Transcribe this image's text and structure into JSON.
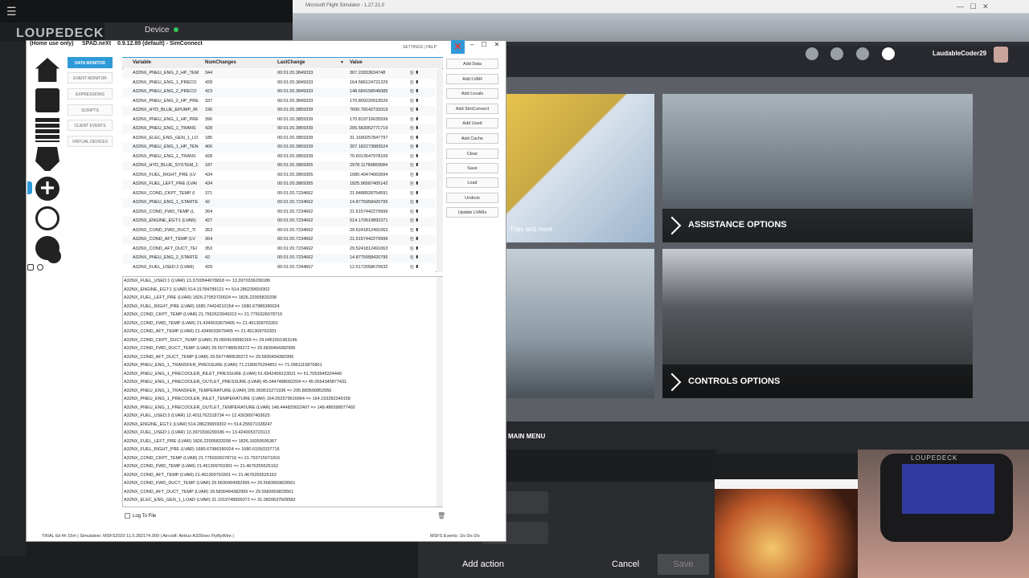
{
  "loupedeck": {
    "logo": "LOUPEDECK",
    "device_label": "Device",
    "buttons": {
      "add_action": "Add action",
      "cancel": "Cancel",
      "save": "Save"
    }
  },
  "msfs": {
    "window_title": "Microsoft Flight Simulator - 1.27.21.0",
    "username": "LaudableCoder29",
    "trips": "Trips and more",
    "assistance": "ASSISTANCE OPTIONS",
    "controls": "CONTROLS OPTIONS",
    "main_menu": "MAIN MENU"
  },
  "spad": {
    "home_use": "(Home use only)",
    "app_name": "SPAD.neXt",
    "version": "0.9.12.89 (default) - SimConnect",
    "settings_help": "SETTINGS | HELP",
    "nav": [
      "DATA MONITOR",
      "EVENT MONITOR",
      "EXPRESSIONS",
      "SCRIPTS",
      "CLIENT EVENTS",
      "VIRTUAL DEVICES"
    ],
    "grid": {
      "headers": [
        "Variable",
        "NumChanges",
        "LastChange",
        "Value"
      ],
      "rows": [
        [
          "A32NX_PNEU_ENG_2_HP_TEM",
          "344",
          "00:01:20.3849333",
          "307.22833634748"
        ],
        [
          "A32NX_PNEU_ENG_1_PRECO",
          "428",
          "00:01:20.3849333",
          "164.586124721229"
        ],
        [
          "A32NX_PNEU_ENG_2_PRECO",
          "423",
          "00:01:20.3849333",
          "148.684158046085"
        ],
        [
          "A32NX_PNEU_ENG_2_HP_PRE",
          "337",
          "00:01:20.3849333",
          "170.809220919526"
        ],
        [
          "A32NX_HYD_BLUE_EPUMP_RI",
          "196",
          "00:01:20.3859339",
          "7600.78142732019"
        ],
        [
          "A32NX_PNEU_ENG_1_HP_PRE",
          "396",
          "00:01:20.3859339",
          "170.819716635599"
        ],
        [
          "A32NX_PNEU_ENG_1_TRANS",
          "428",
          "00:01:20.3859339",
          "205.583052771719"
        ],
        [
          "A32NX_ELEC_ENG_GEN_1_LO",
          "185",
          "00:01:20.3859339",
          "31.1690257847797"
        ],
        [
          "A32NX_PNEU_ENG_1_HP_TEN",
          "406",
          "00:01:20.3859339",
          "307.182273883524"
        ],
        [
          "A32NX_PNEU_ENG_1_TRANS",
          "428",
          "00:01:20.3859339",
          "70.6013547978106"
        ],
        [
          "A32NX_HYD_BLUE_SYSTEM_1",
          "187",
          "00:01:20.3869355",
          "2978.11789869584"
        ],
        [
          "A32NX_FUEL_RIGHT_PRE (LV",
          "434",
          "00:01:20.3869355",
          "1680.40474063694"
        ],
        [
          "A32NX_FUEL_LEFT_PRE (LVAI",
          "434",
          "00:01:20.3869355",
          "1825.96587405142"
        ],
        [
          "A32NX_COND_CKPT_TEMP (I",
          "371",
          "00:01:20.7234662",
          "21.8488928754591"
        ],
        [
          "A32NX_PNEU_ENG_1_STARTE",
          "42",
          "00:01:20.7234662",
          "14.8775958420795"
        ],
        [
          "A32NX_COND_FWD_TEMP (L",
          "364",
          "00:01:20.7234662",
          "21.5157442279999"
        ],
        [
          "A32NX_ENGINE_EGT:1 (LVAR)",
          "427",
          "00:01:20.7234662",
          "514.170519892371"
        ],
        [
          "A32NX_COND_FWD_DUCT_TI",
          "353",
          "00:01:20.7234662",
          "29.5241812491063"
        ],
        [
          "A32NX_COND_AFT_TEMP (LV",
          "364",
          "00:01:20.7234662",
          "21.5157442279999"
        ],
        [
          "A32NX_COND_AFT_DUCT_TEI",
          "353",
          "00:01:20.7234662",
          "29.5241812491063"
        ],
        [
          "A32NX_PNEU_ENG_2_STARTE",
          "42",
          "00:01:20.7234662",
          "14.8775958420795"
        ],
        [
          "A32NX_FUEL_USED:2 (LVAR)",
          "429",
          "00:01:20.7244667",
          "12.5172058670632"
        ]
      ]
    },
    "actions": [
      "Add Data",
      "Add LVAR",
      "Add Locals",
      "Add SimConnect",
      "Add Used",
      "Add Cache",
      "Clear",
      "Save",
      "Load",
      "Undock",
      "Update LVARs"
    ],
    "log": [
      "A32NX_FUEL_USED:1 (LVAR) 13.3700544078818 => 13.3970336299186",
      "A32NX_ENGINE_EGT:1 (LVAR) 514.31784789121 => 514.286239659302",
      "A32NX_FUEL_LEFT_PRE (LVAR) 1826.27953720024 => 1826.22005833208",
      "A32NX_FUEL_RIGHT_PRE (LVAR) 1680.74424210154 => 1680.67986390024",
      "A32NX_COND_CKPT_TEMP (LVAR) 21.7562623949313 => 21.7750326078716",
      "A32NX_COND_FWD_TEMP (LVAR) 21.4349033679405 => 21.451309763301",
      "A32NX_COND_AFT_TEMP (LVAR) 21.4349033679405 => 21.451309763301",
      "A32NX_COND_CKPT_DUCT_TEMP (LVAR) 29.0604109990169 => 29.0451561963146",
      "A32NX_COND_FWD_DUCT_TEMP (LVAR) 29.5977480539272 => 29.5830494382995",
      "A32NX_COND_AFT_DUCT_TEMP (LVAR) 29.5977480539272 => 29.5830494382995",
      "A32NX_PNEU_ENG_1_TRANSFER_PRESSURE (LVAR) 71.2180076294851 => 71.0961115875801",
      "A32NX_PNEU_ENG_1_PRECOOLER_INLET_PRESSURE (LVAR) 51.6942499123021 => 51.7053645324449",
      "A32NX_PNEU_ENG_1_PRECOOLER_OUTLET_PRESSURE (LVAR) 45.0447488092204 => 45.0554345877431",
      "A32NX_PNEU_ENG_1_TRANSFER_TEMPERATURE (LVAR) 205.959515271936 => 205.883590852956",
      "A32NX_PNEU_ENG_1_PRECOOLER_INLET_TEMPERATURE (LVAR) 164.052579616664 => 164.153282349158",
      "A32NX_PNEU_ENG_1_PRECOOLER_OUTLET_TEMPERATURE (LVAR) 148.444829022407 => 148.486598077492",
      "A32NX_FUEL_USED:2 (LVAR) 12.4011762318734 => 12.4303697403625",
      "A32NX_ENGINE_EGT:1 (LVAR) 514.286239659302 => 514.255671028247",
      "A32NX_FUEL_USED:1 (LVAR) 13.3970336299186 => 13.4240053723113",
      "A32NX_FUEL_LEFT_PRE (LVAR) 1826.22005833208 => 1826.16059595367",
      "A32NX_FUEL_RIGHT_PRE (LVAR) 1680.67986390024 => 1680.61550337716",
      "A32NX_COND_CKPT_TEMP (LVAR) 21.7750326078716 => 21.793715071816",
      "A32NX_COND_FWD_TEMP (LVAR) 21.451309763301 => 21.4676255525162",
      "A32NX_COND_AFT_TEMP (LVAR) 21.451309763301 => 21.4676255525162",
      "A32NX_COND_FWD_DUCT_TEMP (LVAR) 29.5830494382995 => 29.5683659829561",
      "A32NX_COND_AFT_DUCT_TEMP (LVAR) 29.5830494382995 => 29.5683659829561",
      "A32NX_ELEC_ENG_GEN_1_LOAD (LVAR) 31.1019748955072 => 31.0820637509582"
    ],
    "log_to_file": "Log To File",
    "status_left": "TRIAL 6d 4h 15m  |  Simulation: MSFS2020 11.0.282174.999  |  Aircraft: Airbus A320neo FlyByWire  |",
    "status_right": "MSFS   Events: 1/s 0/s 0/s",
    "accent": "#2f9ad8"
  }
}
